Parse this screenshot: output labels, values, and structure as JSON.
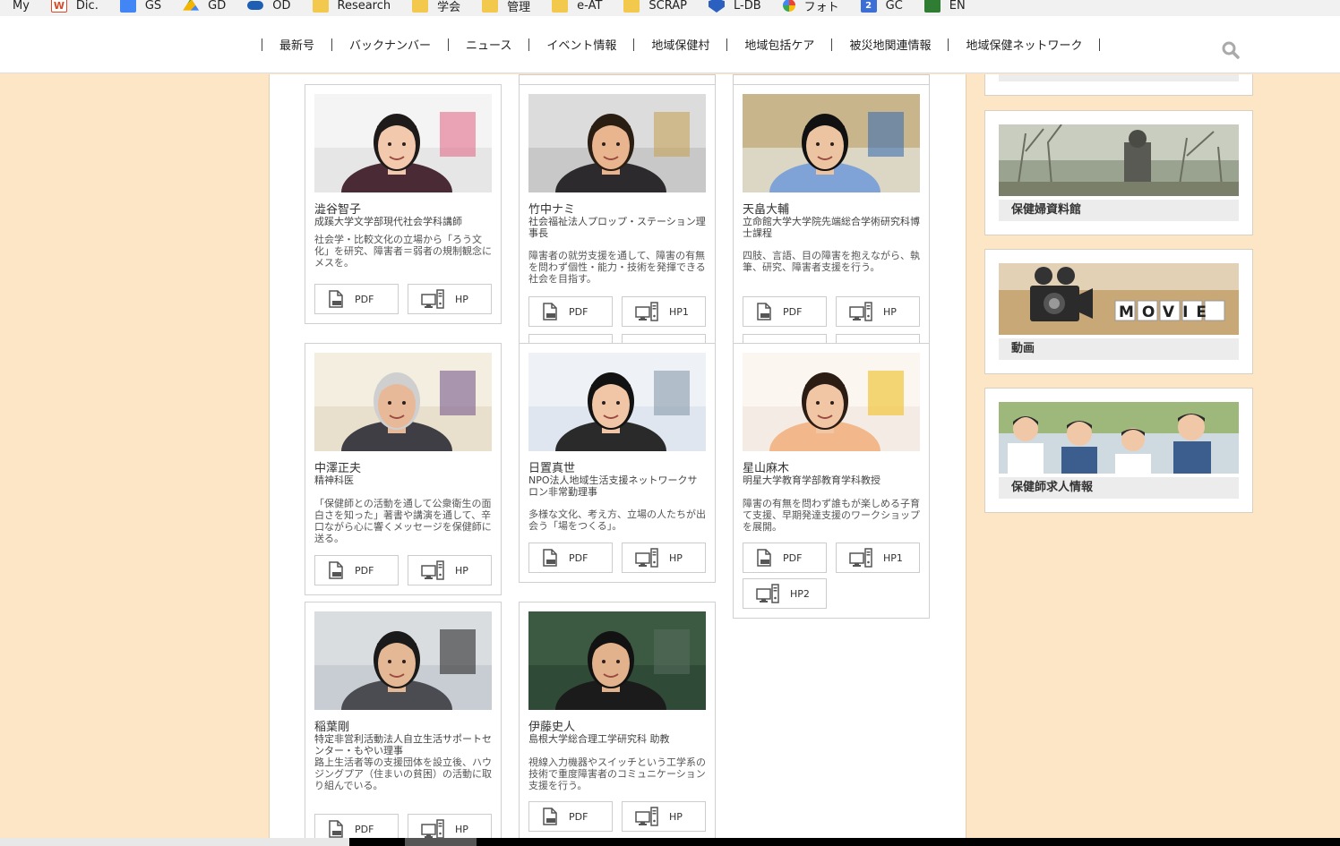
{
  "bookmarks": [
    {
      "label": "My",
      "icon": "none"
    },
    {
      "label": "Dic.",
      "icon": "w-icon"
    },
    {
      "label": "GS",
      "icon": "scholar-icon"
    },
    {
      "label": "GD",
      "icon": "drive-icon"
    },
    {
      "label": "OD",
      "icon": "onedrive-icon"
    },
    {
      "label": "Research",
      "icon": "folder-icon"
    },
    {
      "label": "学会",
      "icon": "folder-icon"
    },
    {
      "label": "管理",
      "icon": "folder-icon"
    },
    {
      "label": "e-AT",
      "icon": "folder-icon"
    },
    {
      "label": "SCRAP",
      "icon": "folder-icon"
    },
    {
      "label": "L-DB",
      "icon": "shield-icon"
    },
    {
      "label": "フォト",
      "icon": "photos-icon"
    },
    {
      "label": "GC",
      "icon": "calendar-icon"
    },
    {
      "label": "EN",
      "icon": "evernote-icon"
    }
  ],
  "nav": {
    "items": [
      "最新号",
      "バックナンバー",
      "ニュース",
      "イベント情報",
      "地域保健村",
      "地域包括ケア",
      "被災地関連情報",
      "地域保健ネットワーク"
    ]
  },
  "cards": [
    {
      "name": "澁谷智子",
      "aff": "成蹊大学文学部現代社会学科講師",
      "desc": "社会学・比較文化の立場から「ろう文化」を研究、障害者＝弱者の規制観念にメスを。",
      "buttons": [
        "PDF",
        "HP"
      ]
    },
    {
      "name": "竹中ナミ",
      "aff": "社会福祉法人プロップ・ステーション理事長",
      "desc": "障害者の就労支援を通して、障害の有無を問わず個性・能力・技術を発揮できる社会を目指す。",
      "buttons": [
        "PDF",
        "HP1"
      ]
    },
    {
      "name": "天畠大輔",
      "aff": "立命館大学大学院先端総合学術研究科博士課程",
      "desc": "四肢、言語、目の障害を抱えながら、執筆、研究、障害者支援を行う。",
      "buttons": [
        "PDF",
        "HP"
      ]
    },
    {
      "name": "中澤正夫",
      "aff": "精神科医",
      "desc": "「保健師との活動を通して公衆衛生の面白さを知った」著書や講演を通して、辛口ながら心に響くメッセージを保健師に送る。",
      "buttons": [
        "PDF",
        "HP"
      ]
    },
    {
      "name": "日置真世",
      "aff": "NPO法人地域生活支援ネットワークサロン非常勤理事",
      "desc": "多様な文化、考え方、立場の人たちが出会う「場をつくる」。",
      "buttons": [
        "PDF",
        "HP"
      ]
    },
    {
      "name": "星山麻木",
      "aff": "明星大学教育学部教育学科教授",
      "desc": "障害の有無を問わず誰もが楽しめる子育て支援、早期発達支援のワークショップを展開。",
      "buttons": [
        "PDF",
        "HP1",
        "HP2"
      ]
    },
    {
      "name": "稲葉剛",
      "aff": "特定非営利活動法人自立生活サポートセンター・もやい理事",
      "desc": "路上生活者等の支援団体を設立後、ハウジングプア（住まいの貧困）の活動に取り組んでいる。",
      "buttons": [
        "PDF",
        "HP"
      ]
    },
    {
      "name": "伊藤史人",
      "aff": "島根大学総合理工学研究科 助教",
      "desc": "視線入力機器やスイッチという工学系の技術で重度障害者のコミュニケーション支援を行う。",
      "buttons": [
        "PDF",
        "HP"
      ]
    }
  ],
  "sidebar": {
    "items": [
      "保健婦資料館",
      "動画",
      "保健師求人情報"
    ],
    "movie_text": "MOVIE"
  }
}
